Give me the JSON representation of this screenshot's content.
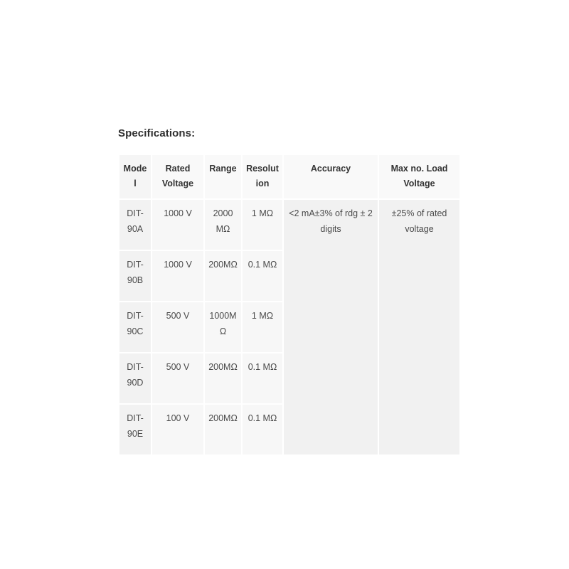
{
  "section": {
    "title": "Specifications:"
  },
  "table": {
    "headers": [
      "Model",
      "Rated Voltage",
      "Range",
      "Resolution",
      "Accuracy",
      "Max no. Load Voltage"
    ],
    "rows": [
      {
        "model": "DIT-90A",
        "rated_voltage": "1000 V",
        "range": "2000 MΩ",
        "resolution": "1 MΩ"
      },
      {
        "model": "DIT-90B",
        "rated_voltage": "1000 V",
        "range": "200MΩ",
        "resolution": "0.1 MΩ"
      },
      {
        "model": "DIT-90C",
        "rated_voltage": "500 V",
        "range": "1000MΩ",
        "resolution": "1 MΩ"
      },
      {
        "model": "DIT-90D",
        "rated_voltage": "500 V",
        "range": "200MΩ",
        "resolution": "0.1 MΩ"
      },
      {
        "model": "DIT-90E",
        "rated_voltage": "100 V",
        "range": "200MΩ",
        "resolution": "0.1 MΩ"
      }
    ],
    "merged": {
      "accuracy": "<2 mA±3% of rdg ± 2 digits",
      "max_no_load_voltage": "±25% of rated voltage"
    }
  },
  "colors": {
    "page_background": "#ffffff",
    "cell_background": "#f7f7f7",
    "model_cell_background": "#f2f2f2",
    "merged_cell_background": "#f1f1f1",
    "header_text": "#333333",
    "body_text": "#4a4a4a"
  }
}
